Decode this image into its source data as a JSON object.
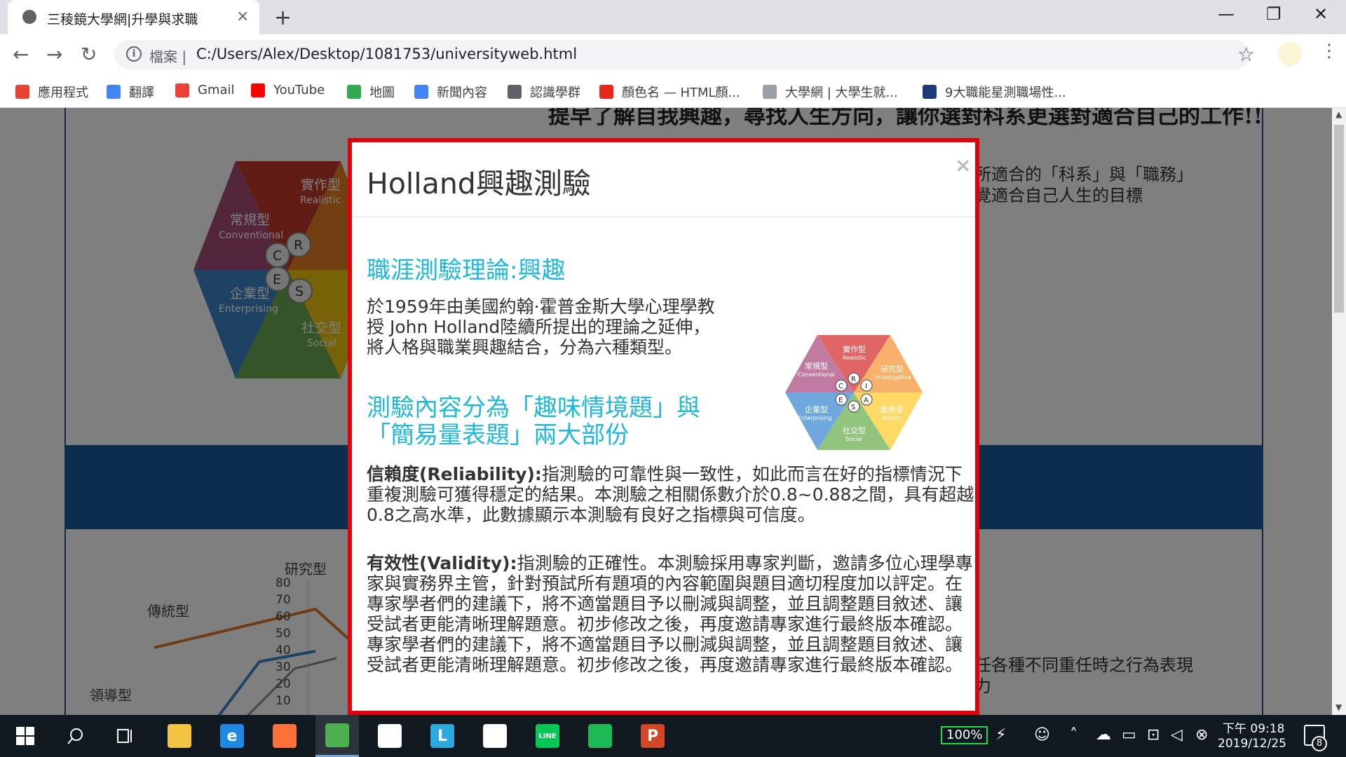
{
  "browser": {
    "tab_title": "三稜鏡大學網|升學與求職",
    "tab_close": "×",
    "new_tab": "+",
    "window": {
      "minimize": "—",
      "restore": "❐",
      "close": "✕"
    },
    "nav": {
      "back": "←",
      "forward": "→",
      "reload": "↻"
    },
    "address_label": "檔案 |",
    "url": "C:/Users/Alex/Desktop/1081753/universityweb.html",
    "star": "☆",
    "menu": "⋮",
    "bookmarks": [
      {
        "label": "應用程式",
        "icon": "apps-grid-icon",
        "color": "#e94235"
      },
      {
        "label": "翻譯",
        "icon": "google-translate-icon",
        "color": "#4285f4"
      },
      {
        "label": "Gmail",
        "icon": "gmail-icon",
        "color": "#ea4335"
      },
      {
        "label": "YouTube",
        "icon": "youtube-icon",
        "color": "#ff0000"
      },
      {
        "label": "地圖",
        "icon": "google-maps-icon",
        "color": "#34a853"
      },
      {
        "label": "新聞內容",
        "icon": "google-news-icon",
        "color": "#4285f4"
      },
      {
        "label": "認識學群",
        "icon": "globe-icon",
        "color": "#5f6368"
      },
      {
        "label": "顏色名 — HTML顏...",
        "icon": "color-name-icon",
        "color": "#e8281d"
      },
      {
        "label": "大學網 | 大學生就...",
        "icon": "document-icon",
        "color": "#9aa0a6"
      },
      {
        "label": "9大職能星測職場性...",
        "icon": "gv-icon",
        "color": "#1a3a7a"
      }
    ]
  },
  "page": {
    "heading": "提早了解自我興趣，尋找人生方向，讓你選對科系更選對適合自己的工作!!",
    "side_text_a": [
      "所適合的「科系」與「職務」",
      "覺適合自己人生的目標"
    ],
    "side_text_b": [
      "任各種不同重任時之行為表現",
      "力"
    ],
    "hex_types": {
      "realistic_zh": "實作型",
      "realistic_en": "Realistic",
      "conventional_zh": "常規型",
      "conventional_en": "Conventional",
      "enterprising_zh": "企業型",
      "enterprising_en": "Enterprising",
      "social_zh": "社交型",
      "social_en": "Social",
      "investigative_zh": "研究型",
      "investigative_en": "Investigative",
      "artistic_zh": "藝術型",
      "artistic_en": "Artistic"
    },
    "hex_letters": {
      "r": "R",
      "i": "I",
      "a": "A",
      "s": "S",
      "e": "E",
      "c": "C"
    },
    "radar": {
      "label_research": "研究型",
      "label_traditional": "傳統型",
      "label_leading": "領導型",
      "ticks": [
        "80",
        "70",
        "60",
        "50",
        "40",
        "30",
        "20",
        "10"
      ]
    }
  },
  "modal": {
    "title": "Holland興趣測驗",
    "close": "×",
    "section1_heading": "職涯測驗理論:興趣",
    "section1_body": "於1959年由美國約翰·霍普金斯大學心理學教授 John Holland陸續所提出的理論之延伸，將人格與職業興趣結合，分為六種類型。",
    "section2_heading": "測驗內容分為「趣味情境題」與「簡易量表題」兩大部份",
    "reliability_label": "信賴度(Reliability):",
    "reliability_text": "指測驗的可靠性與一致性，如此而言在好的指標情況下重複測驗可獲得穩定的結果。本測驗之相關係數介於0.8~0.88之間，具有超越0.8之高水準，此數據顯示本測驗有良好之指標與可信度。",
    "validity_label": "有效性(Validity):",
    "validity_text": "指測驗的正確性。本測驗採用專家判斷，邀請多位心理學專家與實務界主管，針對預試所有題項的內容範圍與題目適切程度加以評定。在專家學者們的建議下，將不適當題目予以刪減與調整，並且調整題目敘述、讓受試者更能清晰理解題意。初步修改之後，再度邀請專家進行最終版本確認。 專家學者們的建議下，將不適當題目予以刪減與調整，並且調整題目敘述、讓受試者更能清晰理解題意。初步修改之後，再度邀請專家進行最終版本確認。"
  },
  "taskbar": {
    "apps": [
      {
        "name": "file-explorer",
        "color": "#f4c542",
        "glyph": ""
      },
      {
        "name": "edge",
        "color": "#1e88e5",
        "glyph": "e"
      },
      {
        "name": "firefox",
        "color": "#ff7139",
        "glyph": ""
      },
      {
        "name": "chrome",
        "color": "#4caf50",
        "glyph": ""
      },
      {
        "name": "store",
        "color": "#ffffff",
        "glyph": ""
      },
      {
        "name": "l-app",
        "color": "#29a9e0",
        "glyph": "L"
      },
      {
        "name": "mail",
        "color": "#ffffff",
        "glyph": ""
      },
      {
        "name": "line",
        "color": "#06c755",
        "glyph": "LINE"
      },
      {
        "name": "spotify",
        "color": "#1db954",
        "glyph": ""
      },
      {
        "name": "powerpoint",
        "color": "#d24726",
        "glyph": "P"
      }
    ],
    "battery": "100%",
    "clock_time": "下午 09:18",
    "clock_date": "2019/12/25",
    "notification_count": "8"
  }
}
